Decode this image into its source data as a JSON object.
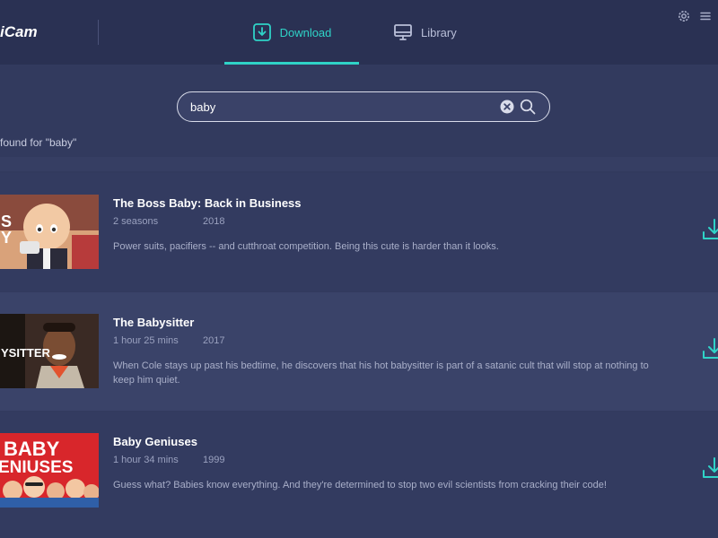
{
  "app": {
    "logo_text": "iCam"
  },
  "tabs": [
    {
      "label": "Download",
      "icon": "download-icon",
      "active": true
    },
    {
      "label": "Library",
      "icon": "monitor-icon",
      "active": false
    }
  ],
  "header_icons": [
    "gear-icon",
    "menu-icon"
  ],
  "search": {
    "value": "baby",
    "placeholder": ""
  },
  "results_summary": "found for \"baby\"",
  "colors": {
    "accent": "#2fd3c7",
    "header_bg": "#2a3153",
    "body_bg": "#323a5e"
  },
  "results": [
    {
      "title": "The Boss Baby: Back in Business",
      "duration": "2 seasons",
      "year": "2018",
      "description": "Power suits, pacifiers -- and cutthroat competition. Being this cute is harder than it looks.",
      "thumb_text": "S\nY"
    },
    {
      "title": "The Babysitter",
      "duration": "1 hour 25 mins",
      "year": "2017",
      "description": "When Cole stays up past his bedtime, he discovers that his hot babysitter is part of a satanic cult that will stop at nothing to keep him quiet.",
      "thumb_text": "YSITTER"
    },
    {
      "title": "Baby Geniuses",
      "duration": "1 hour 34 mins",
      "year": "1999",
      "description": "Guess what? Babies know everything. And they're determined to stop two evil scientists from cracking their code!",
      "thumb_text_1": "BABY",
      "thumb_text_2": "ENIUSES"
    }
  ]
}
